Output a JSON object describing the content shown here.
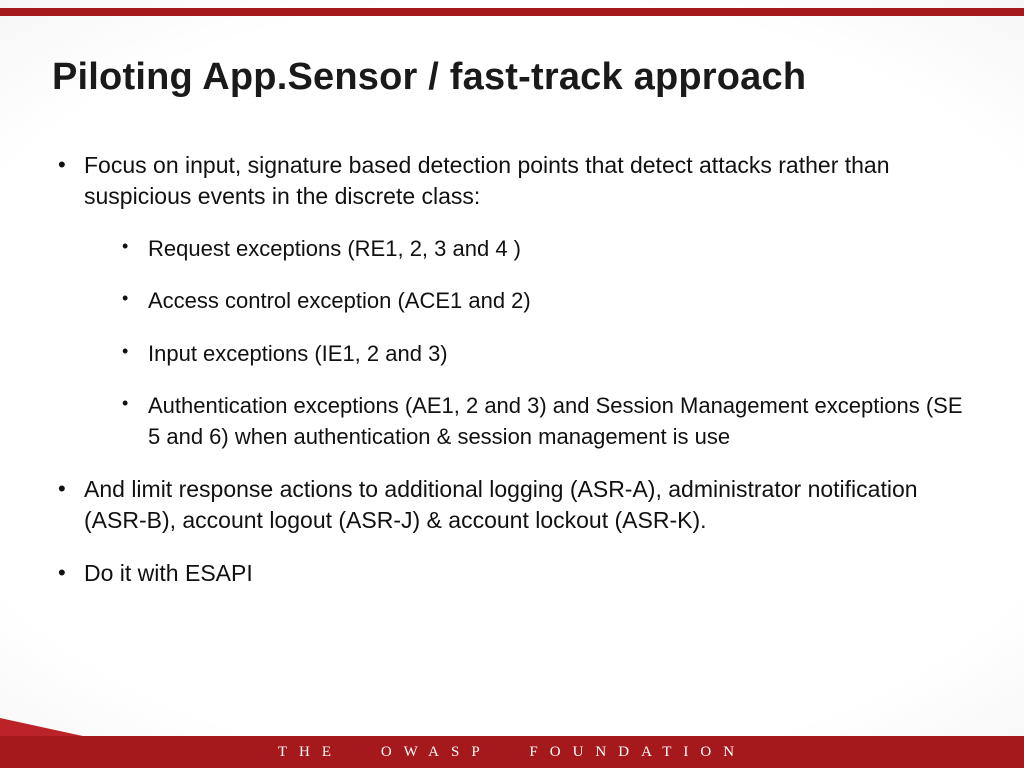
{
  "title": "Piloting App.Sensor / fast-track approach",
  "bullets": {
    "b1": "Focus on input, signature based detection points that detect attacks rather than suspicious events in the discrete class:",
    "sub": {
      "s1": "Request exceptions (RE1, 2, 3 and 4 )",
      "s2": "Access control exception (ACE1 and 2)",
      "s3": "Input exceptions (IE1, 2 and 3)",
      "s4": "Authentication exceptions (AE1, 2 and 3) and Session Management exceptions (SE 5 and 6) when authentication & session management is use"
    },
    "b2": "And limit response actions to additional logging (ASR-A), administrator notification (ASR-B), account logout (ASR-J) & account lockout (ASR-K).",
    "b3": "Do it with ESAPI"
  },
  "footer": {
    "w1": "THE",
    "w2": "OWASP",
    "w3": "FOUNDATION"
  }
}
